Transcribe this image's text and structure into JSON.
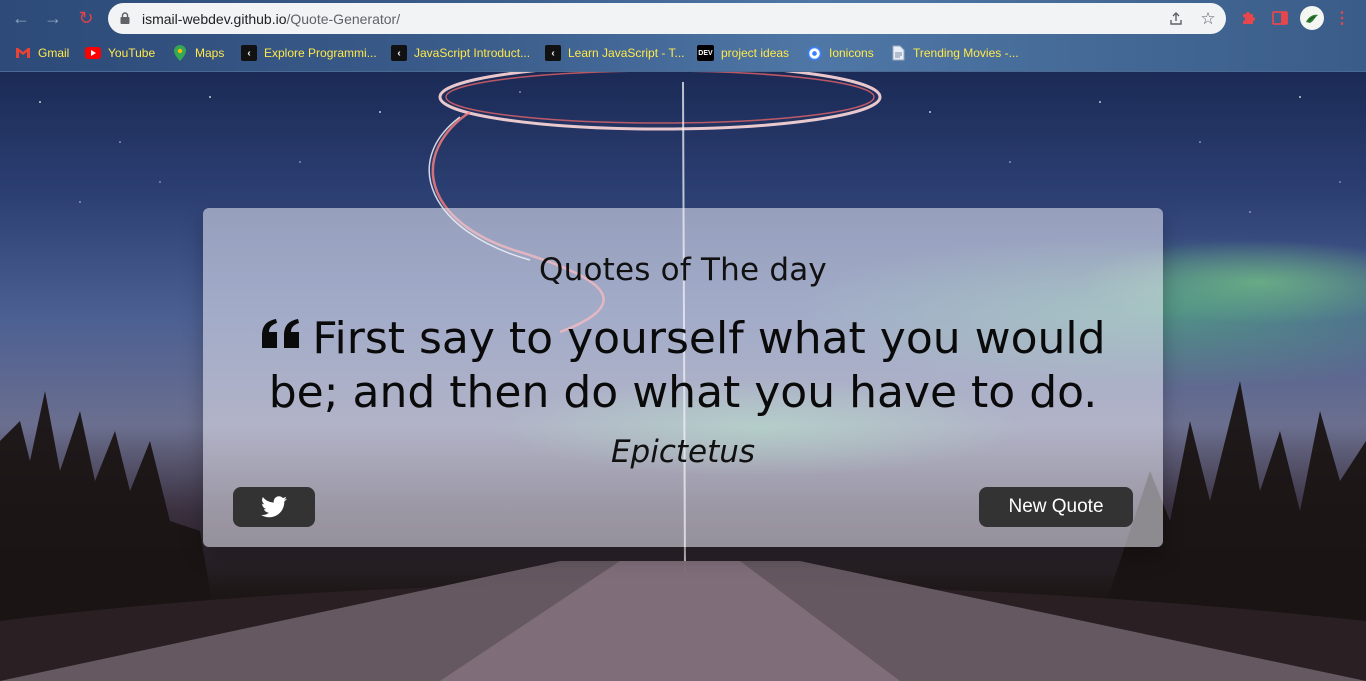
{
  "browser": {
    "url_host": "ismail-webdev.github.io",
    "url_path": "/Quote-Generator/",
    "bookmarks": [
      {
        "label": "Gmail",
        "icon": "gmail-icon"
      },
      {
        "label": "YouTube",
        "icon": "youtube-icon"
      },
      {
        "label": "Maps",
        "icon": "maps-icon"
      },
      {
        "label": "Explore Programmi...",
        "icon": "codecademy-icon"
      },
      {
        "label": "JavaScript Introduct...",
        "icon": "codecademy-icon"
      },
      {
        "label": "Learn JavaScript - T...",
        "icon": "codecademy-icon"
      },
      {
        "label": "project ideas",
        "icon": "dev-icon"
      },
      {
        "label": "Ionicons",
        "icon": "ionicons-icon"
      },
      {
        "label": "Trending Movies -...",
        "icon": "document-icon"
      }
    ],
    "colors": {
      "bookmark_text": "#ffe94a",
      "accent_red": "#e5474d"
    }
  },
  "card": {
    "title": "Quotes of The day",
    "quote": "First say to yourself what you would be; and then do what you have to do.",
    "author": "Epictetus",
    "new_quote_label": "New Quote",
    "twitter_icon": "twitter-icon",
    "quote_icon": "quote-left-icon",
    "button_color": "#333333"
  }
}
